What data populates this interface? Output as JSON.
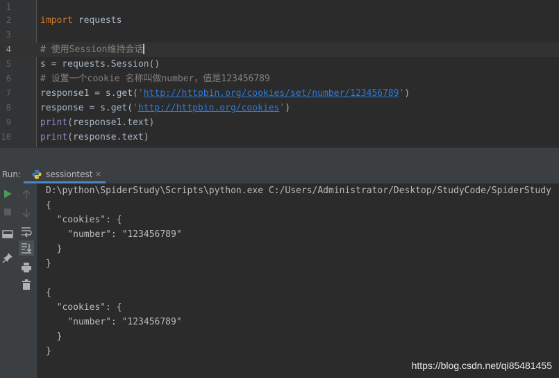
{
  "editor": {
    "line_numbers": [
      "1",
      "2",
      "3",
      "4",
      "5",
      "6",
      "7",
      "8",
      "9",
      "10"
    ],
    "active_line": "4",
    "lines": {
      "l2_kw": "import",
      "l2_rest": " requests",
      "l4_comment": "# 使用Session维持会话",
      "l5_code": "s = requests.Session()",
      "l6_comment": "# 设置一个cookie 名称叫做number，值是123456789",
      "l7_a": "response1 = s.get(",
      "l7_q1": "'",
      "l7_url": "http://httpbin.org/cookies/set/number/123456789",
      "l7_q2": "'",
      "l7_b": ")",
      "l8_a": "response = s.get(",
      "l8_q1": "'",
      "l8_url": "http://httpbin.org/cookies",
      "l8_q2": "'",
      "l8_b": ")",
      "l9_print": "print",
      "l9_rest": "(response1.text)",
      "l10_print": "print",
      "l10_rest": "(response.text)"
    }
  },
  "run": {
    "label": "Run:",
    "tab_label": "sessiontest",
    "close": "×",
    "icons": {
      "run": "run-icon",
      "stop": "stop-icon",
      "layout": "layout-icon",
      "pin": "pin-icon",
      "up": "arrow-up-icon",
      "down": "arrow-down-icon",
      "wrap": "soft-wrap-icon",
      "scroll": "scroll-to-end-icon",
      "print": "print-icon",
      "trash": "trash-icon"
    }
  },
  "console": {
    "lines": [
      "D:\\python\\SpiderStudy\\Scripts\\python.exe C:/Users/Administrator/Desktop/StudyCode/SpiderStudy",
      "{",
      "  \"cookies\": {",
      "    \"number\": \"123456789\"",
      "  }",
      "}",
      "",
      "{",
      "  \"cookies\": {",
      "    \"number\": \"123456789\"",
      "  }",
      "}"
    ]
  },
  "watermark": "https://blog.csdn.net/qi85481455",
  "colors": {
    "editor_bg": "#2b2b2b",
    "keyword": "#cc7832",
    "comment": "#808080",
    "string": "#6a8759",
    "link": "#287bde",
    "builtin": "#8888c6",
    "run_green": "#499c54"
  }
}
